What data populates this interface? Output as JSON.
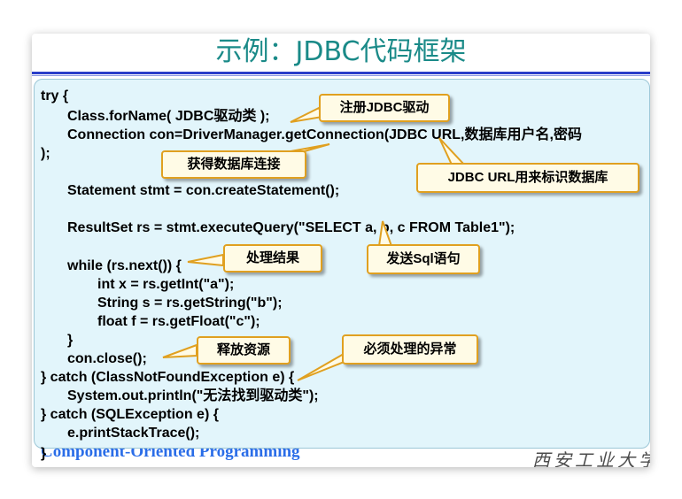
{
  "slide": {
    "title": "示例：JDBC代码框架",
    "footer_left": "Component-Oriented Programming",
    "footer_right": "西安工业大学"
  },
  "code_lines": [
    "try {",
    "Class.forName( JDBC驱动类 );",
    "Connection con=DriverManager.getConnection(JDBC URL,数据库用户名,密码",
    ");",
    "Statement stmt = con.createStatement();",
    "ResultSet rs = stmt.executeQuery(\"SELECT a, b, c FROM Table1\");",
    "while (rs.next()) {",
    "int x = rs.getInt(\"a\");",
    "String s = rs.getString(\"b\");",
    "float f = rs.getFloat(\"c\");",
    "}",
    "con.close();",
    "} catch (ClassNotFoundException e) {",
    "System.out.println(\"无法找到驱动类\");",
    "} catch (SQLException e) {",
    "e.printStackTrace();",
    "}"
  ],
  "callouts": {
    "register_driver": "注册JDBC驱动",
    "get_connection": "获得数据库连接",
    "jdbc_url": "JDBC URL用来标识数据库",
    "send_sql": "发送Sql语句",
    "process_result": "处理结果",
    "release_resources": "释放资源",
    "must_handle_exception": "必须处理的异常"
  },
  "colors": {
    "title": "#1a8a88",
    "rule": "#2a3ec9",
    "panel_bg": "#e2f5fb",
    "callout_bg": "#fffbe6",
    "callout_border": "#e0a020",
    "footer_left": "#2a6de8"
  }
}
